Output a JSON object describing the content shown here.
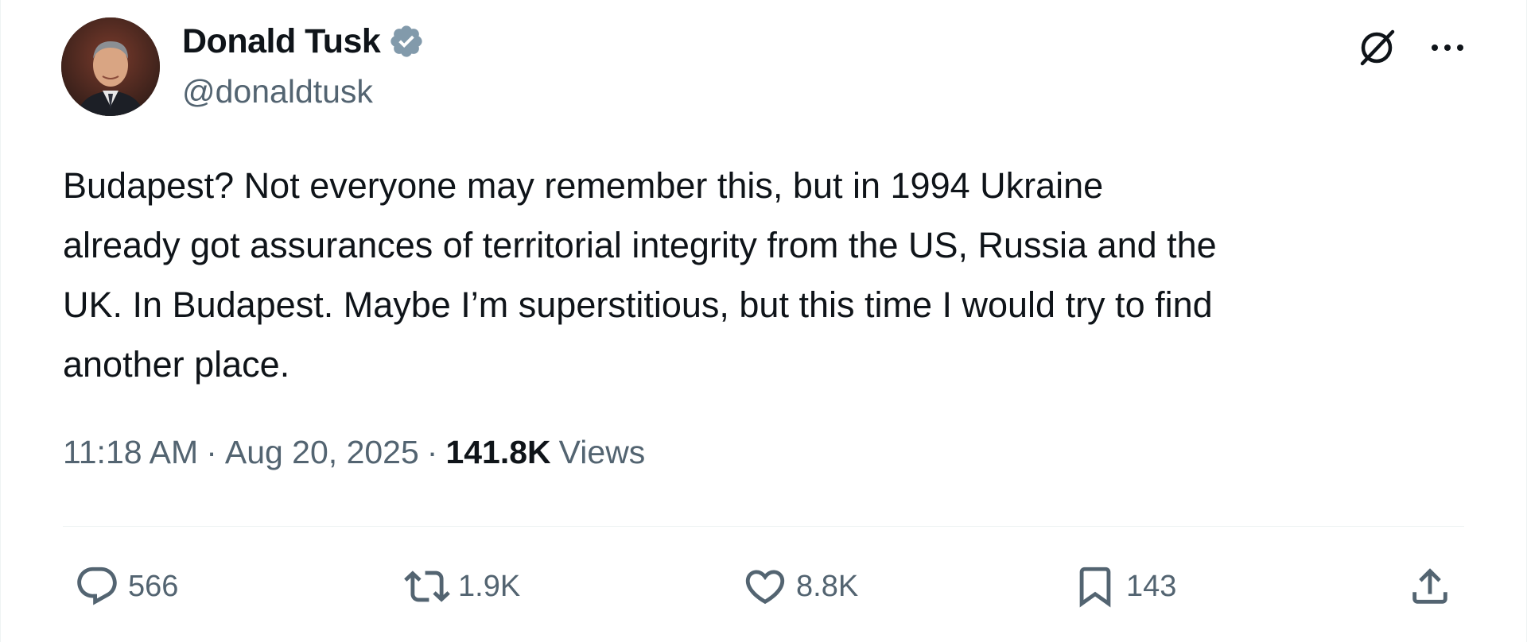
{
  "author": {
    "display_name": "Donald Tusk",
    "handle": "@donaldtusk",
    "verified": true
  },
  "post": {
    "text": "Budapest? Not everyone may remember this, but in 1994 Ukraine\nalready got assurances of territorial integrity from the US, Russia and the\nUK. In Budapest. Maybe I’m superstitious, but this time I would try to find\nanother place.",
    "time": "11:18 AM",
    "date": "Aug 20, 2025",
    "separator": "·",
    "views_count": "141.8K",
    "views_label": "Views"
  },
  "actions": {
    "replies": "566",
    "reposts": "1.9K",
    "likes": "8.8K",
    "bookmarks": "143"
  },
  "icons": {
    "verified": "verified-badge-icon",
    "grok": "grok-icon",
    "more": "more-icon",
    "reply": "reply-icon",
    "repost": "repost-icon",
    "like": "heart-icon",
    "bookmark": "bookmark-icon",
    "share": "share-icon"
  },
  "colors": {
    "text": "#0f1419",
    "secondary": "#536471",
    "verified": "#829aab",
    "divider": "#eff3f4"
  }
}
